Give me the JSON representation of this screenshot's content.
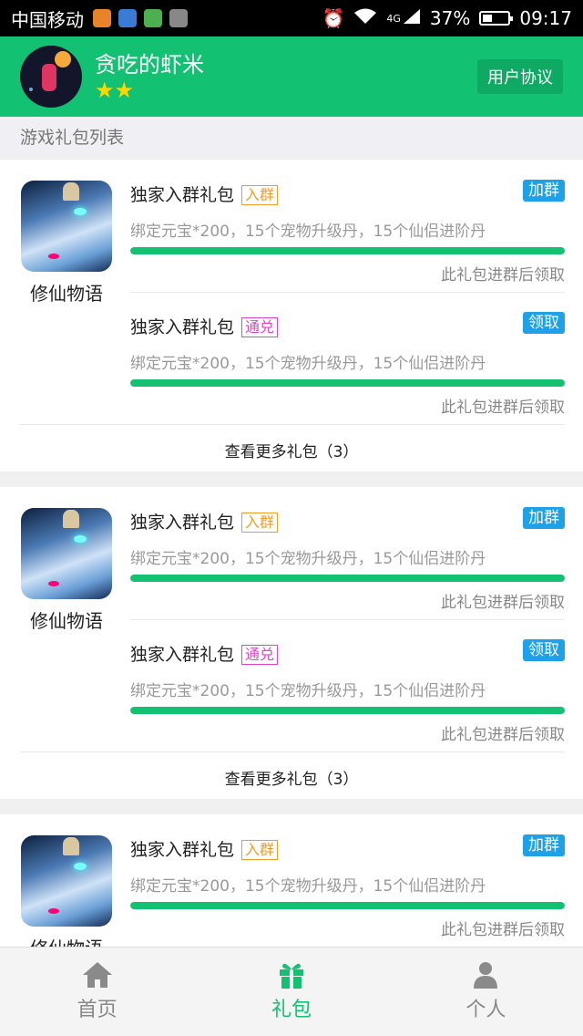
{
  "status_bar": {
    "carrier": "中国移动",
    "network": "4G",
    "battery": "37%",
    "battery_level": 0.37,
    "time": "09:17"
  },
  "header": {
    "username": "贪吃的虾米",
    "stars": "★★",
    "agreement_label": "用户协议"
  },
  "section": {
    "title": "游戏礼包列表"
  },
  "cards": [
    {
      "game_name": "修仙物语",
      "packages": [
        {
          "title": "独家入群礼包",
          "tag": "入群",
          "action": "加群",
          "desc": "绑定元宝*200，15个宠物升级丹，15个仙侣进阶丹",
          "progress": 1.0,
          "note": "此礼包进群后领取"
        },
        {
          "title": "独家入群礼包",
          "tag": "通兑",
          "action": "领取",
          "desc": "绑定元宝*200，15个宠物升级丹，15个仙侣进阶丹",
          "progress": 1.0,
          "note": "此礼包进群后领取"
        }
      ],
      "more": "查看更多礼包（3）"
    },
    {
      "game_name": "修仙物语",
      "packages": [
        {
          "title": "独家入群礼包",
          "tag": "入群",
          "action": "加群",
          "desc": "绑定元宝*200，15个宠物升级丹，15个仙侣进阶丹",
          "progress": 1.0,
          "note": "此礼包进群后领取"
        },
        {
          "title": "独家入群礼包",
          "tag": "通兑",
          "action": "领取",
          "desc": "绑定元宝*200，15个宠物升级丹，15个仙侣进阶丹",
          "progress": 1.0,
          "note": "此礼包进群后领取"
        }
      ],
      "more": "查看更多礼包（3）"
    },
    {
      "game_name": "修仙物语",
      "packages": [
        {
          "title": "独家入群礼包",
          "tag": "入群",
          "action": "加群",
          "desc": "绑定元宝*200，15个宠物升级丹，15个仙侣进阶丹",
          "progress": 1.0,
          "note": "此礼包进群后领取"
        }
      ]
    }
  ],
  "nav": {
    "items": [
      {
        "label": "首页",
        "icon": "home-icon"
      },
      {
        "label": "礼包",
        "icon": "gift-icon"
      },
      {
        "label": "个人",
        "icon": "person-icon"
      }
    ],
    "active": "礼包"
  },
  "colors": {
    "brand": "#12c272",
    "action": "#1ea1e8",
    "tag_orange": "#f39b27",
    "tag_pink": "#e443c6"
  }
}
